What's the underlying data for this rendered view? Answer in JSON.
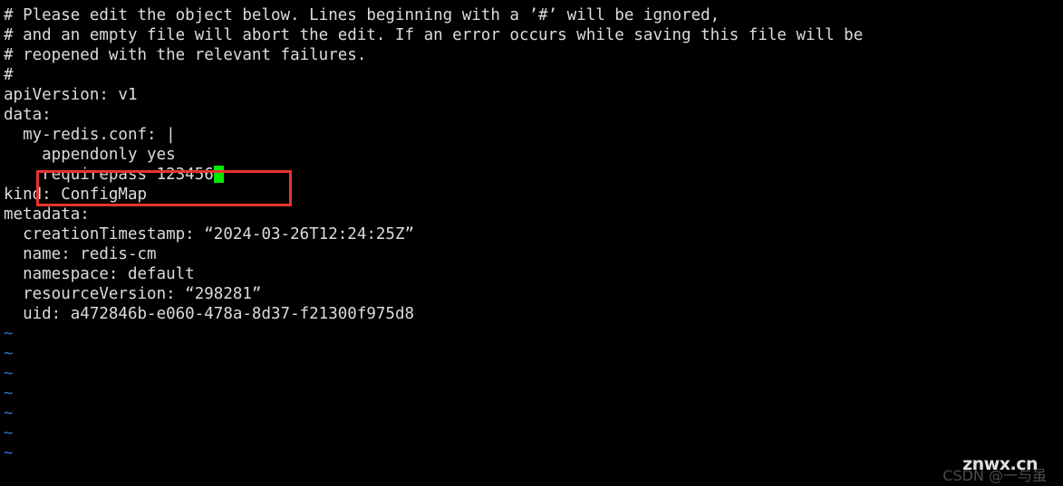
{
  "terminal": {
    "background_color": "#000000",
    "text_color": "#dcdcdc",
    "tilde_color": "#2f6fd0",
    "cursor_color": "#00e800",
    "annotation_color": "#e8342f",
    "lines": [
      "# Please edit the object below. Lines beginning with a ’#’ will be ignored,",
      "# and an empty file will abort the edit. If an error occurs while saving this file will be",
      "# reopened with the relevant failures.",
      "#",
      "apiVersion: v1",
      "data:",
      "  my-redis.conf: |",
      "    appendonly yes",
      "    requirepass 123456",
      "kind: ConfigMap",
      "metadata:",
      "  creationTimestamp: “2024-03-26T12:24:25Z”",
      "  name: redis-cm",
      "  namespace: default",
      "  resourceVersion: “298281”",
      "  uid: a472846b-e060-478a-8d37-f21300f975d8"
    ],
    "empty_line_marker": "~",
    "empty_line_count": 7,
    "cursor": {
      "on_line_index": 8,
      "after_text": "    requirepass 123456"
    }
  },
  "annotation": {
    "label": "red-highlight-rectangle",
    "targets_line": "    requirepass 123456"
  },
  "watermarks": {
    "primary": "znwx.cn",
    "secondary": "CSDN @一与虽"
  }
}
